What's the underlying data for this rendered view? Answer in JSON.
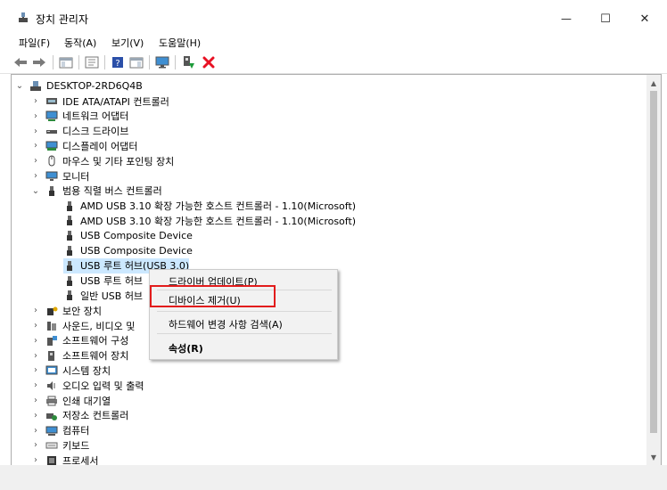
{
  "window": {
    "title": "장치 관리자",
    "min_glyph": "—",
    "max_glyph": "☐",
    "close_glyph": "✕"
  },
  "menu": [
    {
      "label": "파일(F)"
    },
    {
      "label": "동작(A)"
    },
    {
      "label": "보기(V)"
    },
    {
      "label": "도움말(H)"
    }
  ],
  "toolbar": {
    "icons": [
      "back-icon",
      "forward-icon",
      "show-hide-console-tree-icon",
      "properties-icon",
      "help-icon",
      "action-pane-icon",
      "monitor-icon",
      "update-driver-icon",
      "uninstall-device-icon"
    ],
    "uninstall_color": "#e81123"
  },
  "tree": {
    "root": "DESKTOP-2RD6Q4B",
    "categories": [
      {
        "label": "IDE ATA/ATAPI 컨트롤러",
        "icon": "ide-controller-icon",
        "expanded": false
      },
      {
        "label": "네트워크 어댑터",
        "icon": "network-adapter-icon",
        "expanded": false
      },
      {
        "label": "디스크 드라이브",
        "icon": "disk-drive-icon",
        "expanded": false
      },
      {
        "label": "디스플레이 어댑터",
        "icon": "display-adapter-icon",
        "expanded": false
      },
      {
        "label": "마우스 및 기타 포인팅 장치",
        "icon": "mouse-icon",
        "expanded": false
      },
      {
        "label": "모니터",
        "icon": "monitor-icon",
        "expanded": false
      },
      {
        "label": "범용 직렬 버스 컨트롤러",
        "icon": "usb-icon",
        "expanded": true
      }
    ],
    "usb_children": [
      {
        "label": "AMD USB 3.10 확장 가능한 호스트 컨트롤러 - 1.10(Microsoft)"
      },
      {
        "label": "AMD USB 3.10 확장 가능한 호스트 컨트롤러 - 1.10(Microsoft)"
      },
      {
        "label": "USB Composite Device"
      },
      {
        "label": "USB Composite Device"
      },
      {
        "label": "USB 루트 허브(USB 3.0)",
        "selected": true
      },
      {
        "label": "USB 루트 허브"
      },
      {
        "label": "일반 USB 허브"
      }
    ],
    "after": [
      {
        "label": "보안 장치",
        "icon": "security-device-icon"
      },
      {
        "label": "사운드, 비디오 및",
        "icon": "sound-icon"
      },
      {
        "label": "소프트웨어 구성",
        "icon": "software-component-icon"
      },
      {
        "label": "소프트웨어 장치",
        "icon": "software-device-icon"
      },
      {
        "label": "시스템 장치",
        "icon": "system-device-icon"
      },
      {
        "label": "오디오 입력 및 출력",
        "icon": "audio-icon"
      },
      {
        "label": "인쇄 대기열",
        "icon": "printer-icon"
      },
      {
        "label": "저장소 컨트롤러",
        "icon": "storage-controller-icon"
      },
      {
        "label": "컴퓨터",
        "icon": "computer-icon"
      },
      {
        "label": "키보드",
        "icon": "keyboard-icon"
      },
      {
        "label": "프로세서",
        "icon": "processor-icon"
      }
    ]
  },
  "context_menu": {
    "update_driver": "드라이버 업데이트(P)",
    "uninstall_device": "디바이스 제거(U)",
    "scan_hardware": "하드웨어 변경 사항 검색(A)",
    "properties": "속성(R)",
    "highlight_color": "#e21c1c"
  }
}
